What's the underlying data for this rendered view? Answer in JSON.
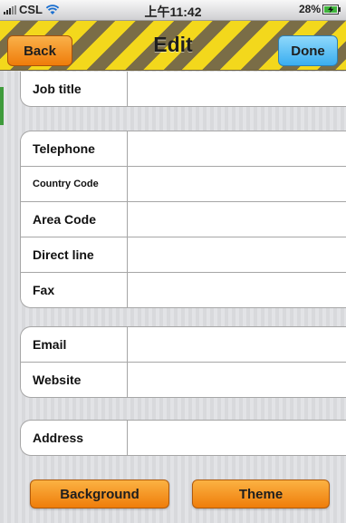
{
  "status_bar": {
    "carrier": "CSL",
    "time": "上午11:42",
    "battery_percent": "28%"
  },
  "nav": {
    "back_label": "Back",
    "title": "Edit",
    "done_label": "Done"
  },
  "groups": {
    "job": [
      {
        "label": "Job title",
        "value": ""
      }
    ],
    "phone": [
      {
        "label": "Telephone",
        "value": ""
      },
      {
        "label": "Country Code",
        "value": ""
      },
      {
        "label": "Area Code",
        "value": ""
      },
      {
        "label": "Direct line",
        "value": ""
      },
      {
        "label": "Fax",
        "value": ""
      }
    ],
    "web": [
      {
        "label": "Email",
        "value": ""
      },
      {
        "label": "Website",
        "value": ""
      }
    ],
    "address": [
      {
        "label": "Address",
        "value": ""
      }
    ]
  },
  "buttons": {
    "background_label": "Background",
    "theme_label": "Theme"
  },
  "colors": {
    "nav_stripe_yellow": "#f3d81c",
    "nav_stripe_dark": "#7a6d47",
    "back_orange": "#ef7c0a",
    "done_blue": "#3aaef0",
    "accent_green": "#3f9b3c"
  }
}
